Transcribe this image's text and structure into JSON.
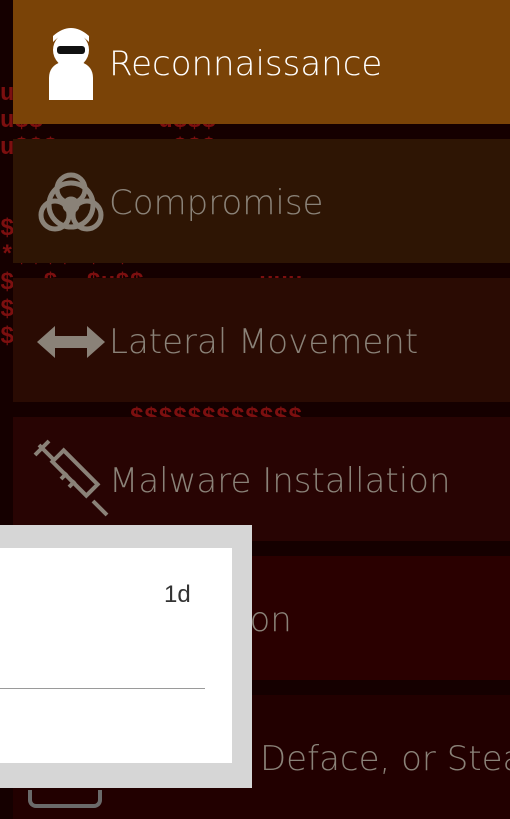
{
  "menu": {
    "items": [
      {
        "label": "Reconnaissance",
        "icon": "hacker-icon",
        "state": "selected"
      },
      {
        "label": "Compromise",
        "icon": "biohazard-icon"
      },
      {
        "label": "Lateral Movement",
        "icon": "double-arrow-icon"
      },
      {
        "label": "Malware Installation",
        "icon": "syringe-icon"
      },
      {
        "label": "ion",
        "icon": ""
      },
      {
        "label": "Deface, or Steal",
        "icon": ""
      }
    ]
  },
  "popup": {
    "time": "1d"
  },
  "colors": {
    "selected": "#7a4307",
    "item2": "#2e1504",
    "item3": "#2a0b03",
    "item4": "#280403",
    "item5": "#2a0000",
    "item6": "#220000"
  }
}
